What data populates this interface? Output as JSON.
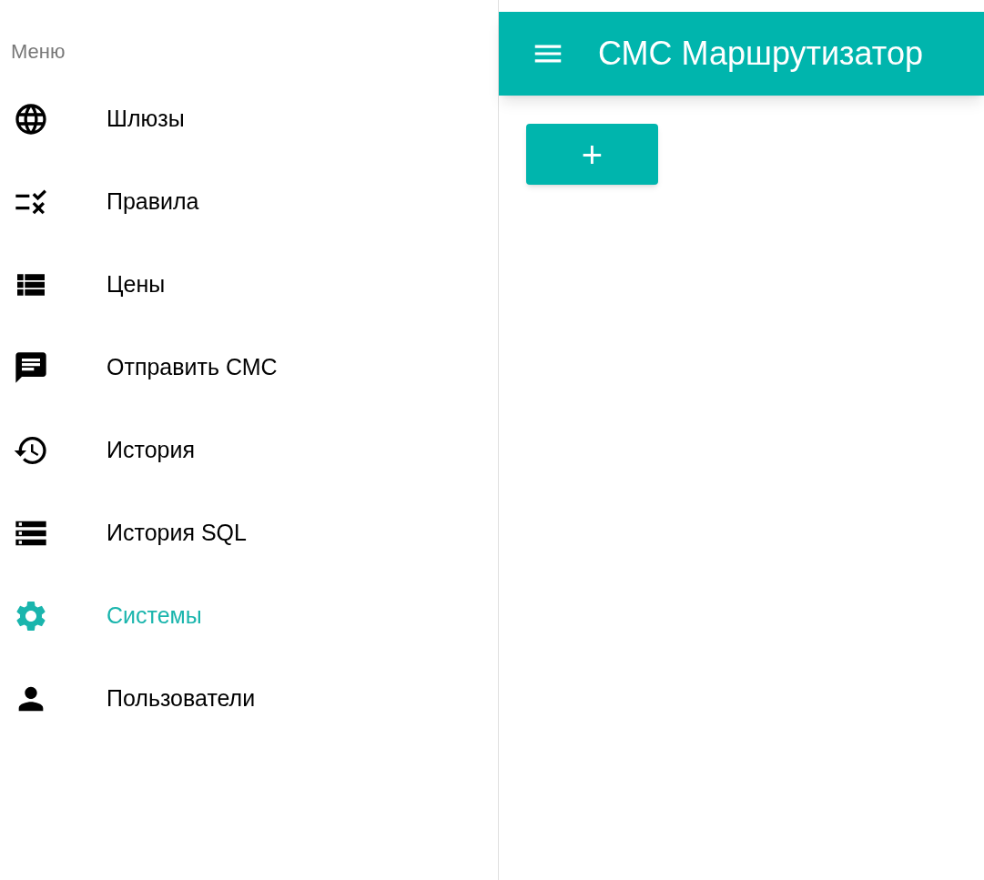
{
  "sidebar": {
    "title": "Меню",
    "items": [
      {
        "label": "Шлюзы",
        "selected": false
      },
      {
        "label": "Правила",
        "selected": false
      },
      {
        "label": "Цены",
        "selected": false
      },
      {
        "label": "Отправить СМС",
        "selected": false
      },
      {
        "label": "История",
        "selected": false
      },
      {
        "label": "История SQL",
        "selected": false
      },
      {
        "label": "Системы",
        "selected": true
      },
      {
        "label": "Пользователи",
        "selected": false
      }
    ]
  },
  "app_bar": {
    "title": "СМС Маршрутизатор"
  },
  "add_button": {
    "label": "+"
  }
}
